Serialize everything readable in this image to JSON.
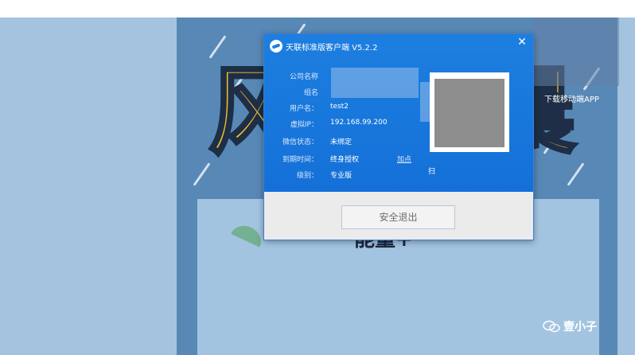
{
  "background": {
    "big_chars": [
      "风",
      "晨"
    ],
    "panel_text": "能量+",
    "download_label": "下载移动端APP"
  },
  "dialog": {
    "title": "天联标准版客户端 V5.2.2",
    "close_glyph": "✕",
    "rows": [
      {
        "label": "公司名称",
        "value": ""
      },
      {
        "label": "组名",
        "value": ""
      },
      {
        "label": "用户名：",
        "value": "test2"
      },
      {
        "label": "虚拟IP：",
        "value": "192.168.99.200"
      },
      {
        "label": "微信状态：",
        "value": "未绑定"
      },
      {
        "label": "到期时间：",
        "value": "终身授权"
      },
      {
        "label": "级别：",
        "value": "专业版"
      }
    ],
    "add_link": "加点",
    "scan_text": "扫",
    "logout_label": "安全退出"
  },
  "watermark": {
    "text": "壹小子"
  },
  "colors": {
    "dialog_blue": "#1470d8",
    "bg_blue": "#5888b6",
    "accent_yellow": "#f7c22a"
  }
}
